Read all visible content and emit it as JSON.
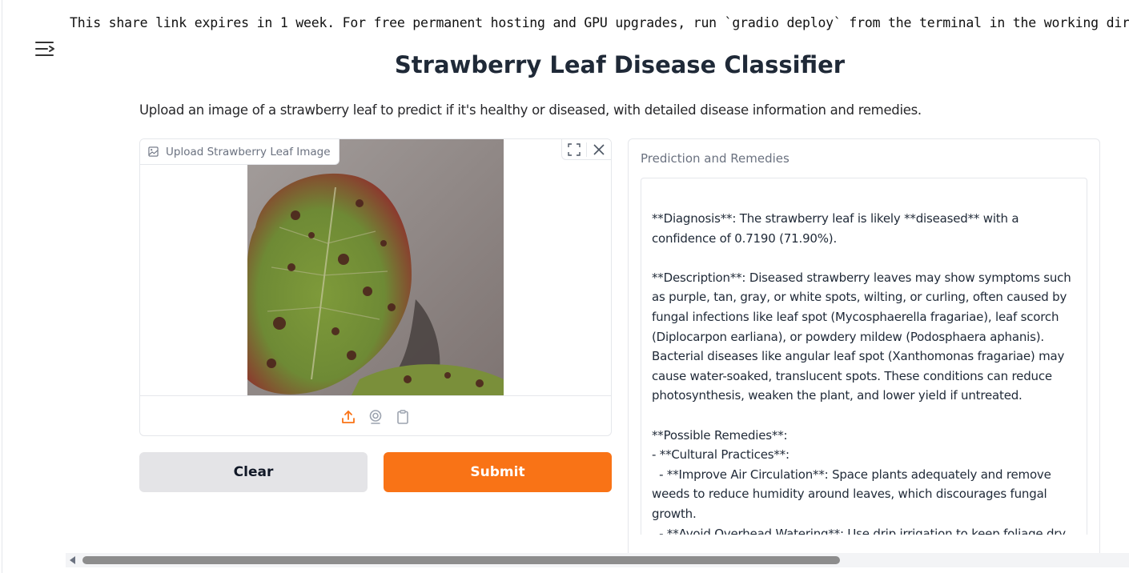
{
  "notice": "This share link expires in 1 week. For free permanent hosting and GPU upgrades, run `gradio deploy` from the terminal in the working directory to deploy to Hugging Face Spaces (https://huggingface.co/spaces)",
  "title": "Strawberry Leaf Disease Classifier",
  "description": "Upload an image of a strawberry leaf to predict if it's healthy or diseased, with detailed disease information and remedies.",
  "image_input": {
    "label": "Upload Strawberry Leaf Image",
    "tools": [
      "fullscreen-icon",
      "close-icon"
    ],
    "sources": [
      "upload-icon",
      "webcam-icon",
      "clipboard-icon"
    ],
    "active_source_color": "#f97316"
  },
  "buttons": {
    "clear": "Clear",
    "submit": "Submit"
  },
  "output": {
    "label": "Prediction and Remedies",
    "text": "**Diagnosis**: The strawberry leaf is likely **diseased** with a confidence of 0.7190 (71.90%).\n\n**Description**: Diseased strawberry leaves may show symptoms such as purple, tan, gray, or white spots, wilting, or curling, often caused by fungal infections like leaf spot (Mycosphaerella fragariae), leaf scorch (Diplocarpon earliana), or powdery mildew (Podosphaera aphanis). Bacterial diseases like angular leaf spot (Xanthomonas fragariae) may cause water-soaked, translucent spots. These conditions can reduce photosynthesis, weaken the plant, and lower yield if untreated.\n\n**Possible Remedies**:\n- **Cultural Practices**:\n  - **Improve Air Circulation**: Space plants adequately and remove weeds to reduce humidity around leaves, which discourages fungal growth.\n  - **Avoid Overhead Watering**: Use drip irrigation to keep foliage dry, as"
  },
  "colors": {
    "accent": "#f97316",
    "clear_bg": "#e4e4e7",
    "border": "#e5e7eb"
  }
}
